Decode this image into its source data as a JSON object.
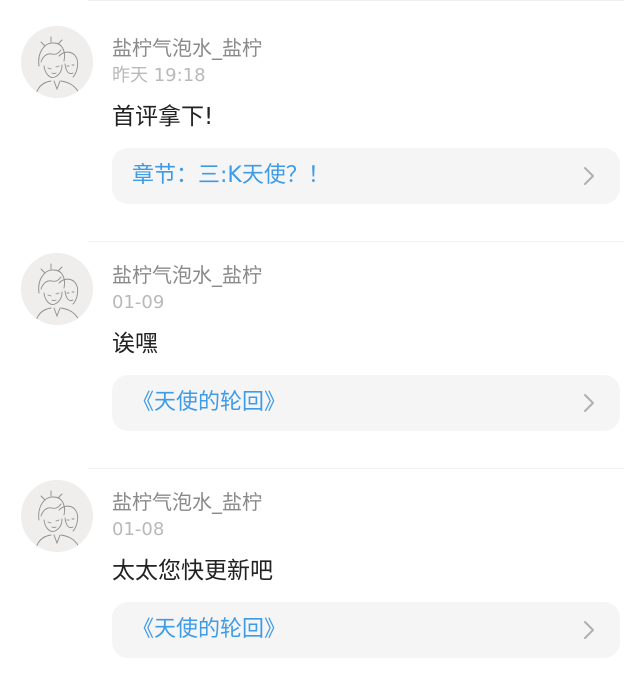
{
  "comments": [
    {
      "username": "盐柠气泡水_盐柠",
      "time": "昨天 19:18",
      "content": "首评拿下!",
      "source": "章节：三:K天使？！"
    },
    {
      "username": "盐柠气泡水_盐柠",
      "time": "01-09",
      "content": "诶嘿",
      "source": "《天使的轮回》"
    },
    {
      "username": "盐柠气泡水_盐柠",
      "time": "01-08",
      "content": "太太您快更新吧",
      "source": "《天使的轮回》"
    }
  ],
  "colors": {
    "username": "#8a8a8a",
    "timestamp": "#b9b9b9",
    "content": "#222222",
    "link": "#3e9be6",
    "link_background": "#f5f5f6"
  },
  "icons": {
    "avatar": "sketch-avatar-icon",
    "chevron": "chevron-right-icon"
  }
}
